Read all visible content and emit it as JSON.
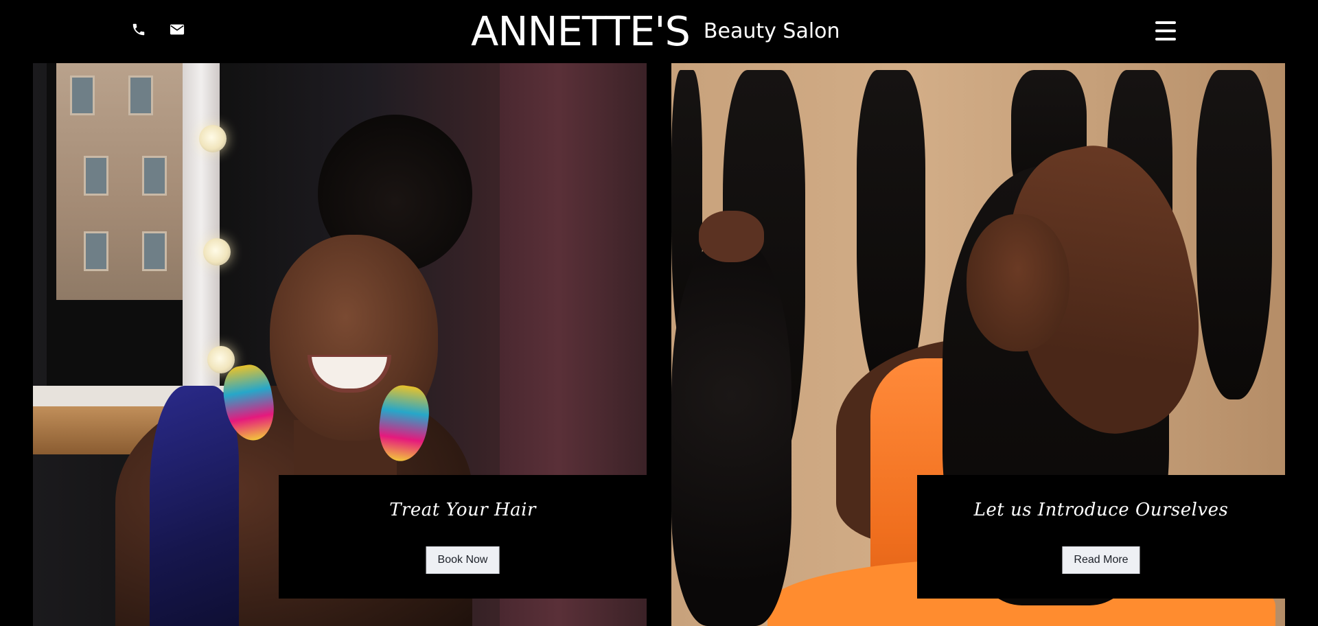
{
  "header": {
    "brand_name": "ANNETTE'S",
    "brand_subtitle": "Beauty Salon",
    "icons": [
      "phone-icon",
      "mail-icon",
      "hamburger-menu-icon"
    ]
  },
  "hero": {
    "cards": [
      {
        "title": "Treat Your Hair",
        "button_label": "Book Now"
      },
      {
        "title": "Let us Introduce Ourselves",
        "button_label": "Read More"
      }
    ]
  },
  "colors": {
    "background": "#000000",
    "text": "#ffffff",
    "button_bg": "#eef0f4",
    "button_text": "#1b1f27"
  }
}
